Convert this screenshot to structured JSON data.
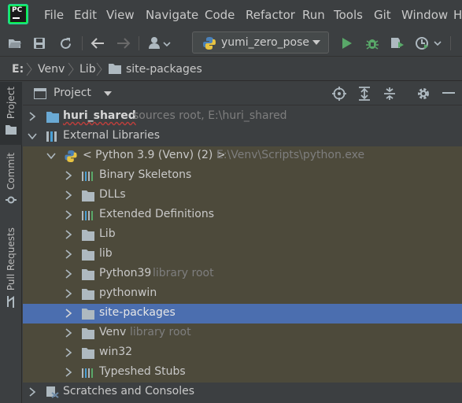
{
  "menu": [
    "File",
    "Edit",
    "View",
    "Navigate",
    "Code",
    "Refactor",
    "Run",
    "Tools",
    "Git",
    "Window",
    "H"
  ],
  "logo_text": "PC",
  "toolbar": {
    "run_config": "yumi_zero_pose"
  },
  "breadcrumb": [
    "E:",
    "Venv",
    "Lib",
    "site-packages"
  ],
  "left_tabs": [
    "Project",
    "Commit",
    "Pull Requests"
  ],
  "panel": {
    "title": "Project"
  },
  "tree": [
    {
      "label": "huri_shared",
      "hint": "sources root,  E:\\huri_shared",
      "icon": "folder-source-icon",
      "chev": "right"
    },
    {
      "label": "External Libraries",
      "hint": "",
      "icon": "library-icon",
      "chev": "down"
    },
    {
      "label": "< Python 3.9 (Venv) (2) >",
      "hint": "E:\\Venv\\Scripts\\python.exe",
      "icon": "python-icon",
      "chev": "down"
    },
    {
      "label": "Binary Skeletons",
      "hint": "",
      "icon": "library-bars-icon",
      "chev": "right"
    },
    {
      "label": "DLLs",
      "hint": "",
      "icon": "folder-icon",
      "chev": "right"
    },
    {
      "label": "Extended Definitions",
      "hint": "",
      "icon": "library-bars-icon",
      "chev": "right"
    },
    {
      "label": "Lib",
      "hint": "",
      "icon": "folder-icon",
      "chev": "right"
    },
    {
      "label": "lib",
      "hint": "",
      "icon": "folder-icon",
      "chev": "right"
    },
    {
      "label": "Python39",
      "hint": "library root",
      "icon": "folder-icon",
      "chev": "right"
    },
    {
      "label": "pythonwin",
      "hint": "",
      "icon": "folder-icon",
      "chev": "right"
    },
    {
      "label": "site-packages",
      "hint": "",
      "icon": "folder-icon",
      "chev": "right"
    },
    {
      "label": "Venv",
      "hint": "library root",
      "icon": "folder-icon",
      "chev": "right"
    },
    {
      "label": "win32",
      "hint": "",
      "icon": "folder-icon",
      "chev": "right"
    },
    {
      "label": "Typeshed Stubs",
      "hint": "",
      "icon": "library-bars-icon",
      "chev": "right"
    },
    {
      "label": "Scratches and Consoles",
      "hint": "",
      "icon": "scratches-icon",
      "chev": "right"
    }
  ],
  "colors": {
    "bg": "#3c3f41",
    "library_row": "#4d4a3b",
    "selected_row": "#4b6eaf",
    "folder": "#aeb9c0",
    "source_folder": "#6aa9d4",
    "run_green": "#59a869"
  }
}
